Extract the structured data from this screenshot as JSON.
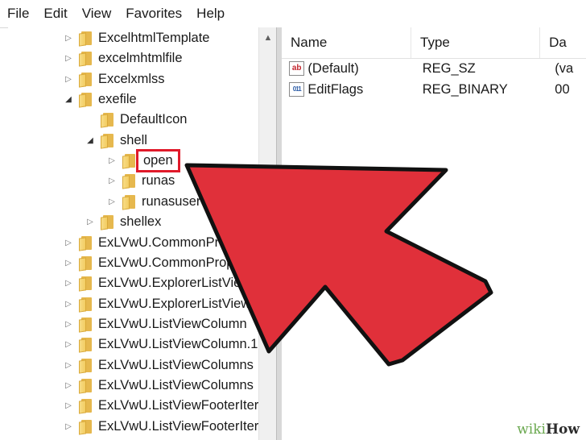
{
  "menu": [
    "File",
    "Edit",
    "View",
    "Favorites",
    "Help"
  ],
  "tree": {
    "items": [
      {
        "label": "ExcelhtmlTemplate",
        "expander": "collapsed"
      },
      {
        "label": "excelmhtmlfile",
        "expander": "collapsed"
      },
      {
        "label": "Excelxmlss",
        "expander": "collapsed"
      },
      {
        "label": "exefile",
        "expander": "expanded"
      },
      {
        "label": "DefaultIcon",
        "expander": "none"
      },
      {
        "label": "shell",
        "expander": "expanded"
      },
      {
        "label": "open",
        "expander": "collapsed",
        "highlighted": true
      },
      {
        "label": "runas",
        "expander": "collapsed"
      },
      {
        "label": "runasuser",
        "expander": "collapsed"
      },
      {
        "label": "shellex",
        "expander": "collapsed"
      },
      {
        "label": "ExLVwU.CommonPropert",
        "expander": "collapsed"
      },
      {
        "label": "ExLVwU.CommonProperti",
        "expander": "collapsed"
      },
      {
        "label": "ExLVwU.ExplorerListView",
        "expander": "collapsed"
      },
      {
        "label": "ExLVwU.ExplorerListView.1",
        "expander": "collapsed"
      },
      {
        "label": "ExLVwU.ListViewColumn",
        "expander": "collapsed"
      },
      {
        "label": "ExLVwU.ListViewColumn.1",
        "expander": "collapsed"
      },
      {
        "label": "ExLVwU.ListViewColumns",
        "expander": "collapsed"
      },
      {
        "label": "ExLVwU.ListViewColumns",
        "expander": "collapsed"
      },
      {
        "label": "ExLVwU.ListViewFooterIter",
        "expander": "collapsed"
      },
      {
        "label": "ExLVwU.ListViewFooterIter",
        "expander": "collapsed"
      }
    ]
  },
  "list": {
    "columns": [
      "Name",
      "Type",
      "Da"
    ],
    "rows": [
      {
        "icon": "string-value-icon",
        "icon_text": "ab",
        "name": "(Default)",
        "type": "REG_SZ",
        "data": "(va"
      },
      {
        "icon": "binary-value-icon",
        "icon_text": "011",
        "name": "EditFlags",
        "type": "REG_BINARY",
        "data": "00"
      }
    ]
  },
  "colors": {
    "highlight": "#e01a2a",
    "arrow": "#e0303a",
    "folder": "#f3cd62"
  },
  "watermark": {
    "part1": "wiki",
    "part2": "How"
  }
}
